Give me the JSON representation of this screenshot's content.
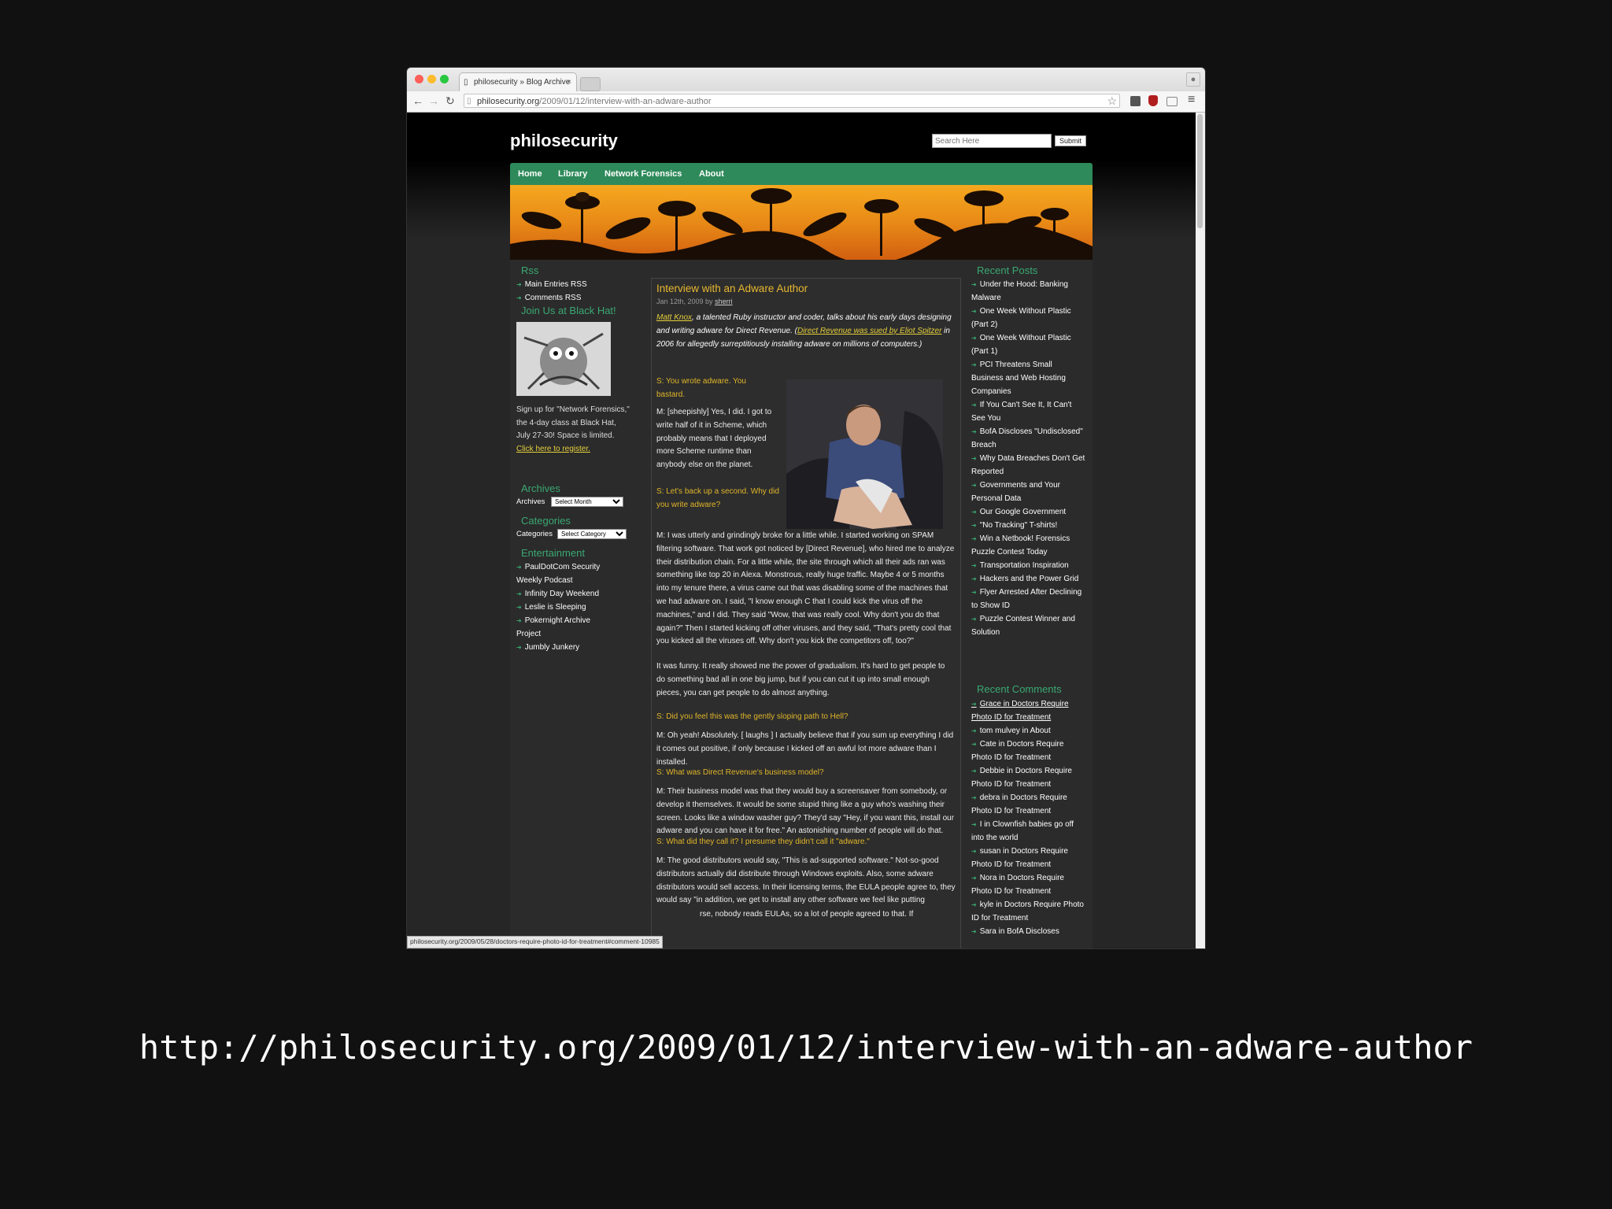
{
  "browser": {
    "tab_title": "philosecurity » Blog Archive",
    "tab_close": "×",
    "url_domain": "philosecurity.org",
    "url_path": "/2009/01/12/interview-with-an-adware-author",
    "status_url": "philosecurity.org/2009/05/28/doctors-require-photo-id-for-treatment#comment-10985",
    "back_glyph": "←",
    "forward_glyph": "→",
    "reload_glyph": "↻",
    "star_glyph": "☆",
    "menu_glyph": "≡"
  },
  "site": {
    "title": "philosecurity",
    "search_placeholder": "Search Here",
    "search_submit": "Submit",
    "nav": [
      "Home",
      "Library",
      "Network Forensics",
      "About"
    ]
  },
  "left_sidebar": {
    "rss_title": "Rss",
    "rss_links": [
      "Main Entries RSS",
      "Comments RSS"
    ],
    "blackhat_title": "Join Us at Black Hat!",
    "blackhat_text": "Sign up for \"Network Forensics,\" the 4-day class at Black Hat, July 27-30! Space is limited.",
    "blackhat_link": "Click here to register.",
    "archives_title": "Archives",
    "archives_label": "Archives",
    "archives_select": "Select Month",
    "categories_title": "Categories",
    "categories_label": "Categories",
    "categories_select": "Select Category",
    "entertainment_title": "Entertainment",
    "entertainment_links": [
      "PaulDotCom Security Weekly Podcast",
      "Infinity Day Weekend",
      "Leslie is Sleeping",
      "Pokernight Archive Project",
      "Jumbly Junkery"
    ]
  },
  "article": {
    "title": "Interview with an Adware Author",
    "date": "Jan 12th, 2009 by",
    "author": "sherri",
    "intro_link1": "Matt Knox",
    "intro_text1": ", a talented Ruby instructor and coder, talks about his early days designing and writing adware for Direct Revenue. (",
    "intro_link2": "Direct Revenue was sued by Eliot Spitzer",
    "intro_text2": " in 2006 for allegedly surreptitiously installing adware on millions of computers.)",
    "q1": "S: You wrote adware. You bastard.",
    "a1": "M: [sheepishly] Yes, I did. I got to write half of it in Scheme, which probably means that I deployed more Scheme runtime than anybody else on the planet.",
    "q2": "S: Let's back up a second. Why did you write adware?",
    "a2": "M: I was utterly and grindingly broke for a little while. I started working on SPAM filtering software. That work got noticed by [Direct Revenue], who hired me to analyze their distribution chain. For a little while, the site through which all their ads ran was something like top 20 in Alexa. Monstrous, really huge traffic. Maybe 4 or 5 months into my tenure there, a virus came out that was disabling some of the machines that we had adware on. I said, \"I know enough C that I could kick the virus off the machines,\" and I did. They said \"Wow, that was really cool. Why don't you do that again?\" Then I started kicking off other viruses, and they said, \"That's pretty cool that you kicked all the viruses off. Why don't you kick the competitors off, too?\"",
    "a2b": "It was funny. It really showed me the power of gradualism. It's hard to get people to do something bad all in one big jump, but if you can cut it up into small enough pieces, you can get people to do almost anything.",
    "q3": "S: Did you feel this was the gently sloping path to Hell?",
    "a3": "M: Oh yeah! Absolutely. [ laughs ] I actually believe that if you sum up everything I did it comes out positive, if only because I kicked off an awful lot more adware than I installed.",
    "q4": "S: What was Direct Revenue's business model?",
    "a4": "M: Their business model was that they would buy a screensaver from somebody, or develop it themselves. It would be some stupid thing like a guy who's washing their screen. Looks like a window washer guy? They'd say \"Hey, if you want this, install our adware and you can have it for free.\" An astonishing number of people will do that.",
    "q5": "S: What did they call it? I presume they didn't call it \"adware.\"",
    "a5": "M: The good distributors would say, \"This is ad-supported software.\" Not-so-good distributors actually did distribute through Windows exploits. Also, some adware distributors would sell access. In their licensing terms, the EULA people agree to, they would say \"in addition, we get to install any other software we feel like putting",
    "a5_tail": "rse, nobody reads EULAs, so a lot of people agreed to that. If"
  },
  "right_sidebar": {
    "recent_posts_title": "Recent Posts",
    "recent_posts": [
      "Under the Hood: Banking Malware",
      "One Week Without Plastic (Part 2)",
      "One Week Without Plastic (Part 1)",
      "PCI Threatens Small Business and Web Hosting Companies",
      "If You Can't See It, It Can't See You",
      "BofA Discloses \"Undisclosed\" Breach",
      "Why Data Breaches Don't Get Reported",
      "Governments and Your Personal Data",
      "Our Google Government",
      "\"No Tracking\" T-shirts!",
      "Win a Netbook! Forensics Puzzle Contest Today",
      "Transportation Inspiration",
      "Hackers and the Power Grid",
      "Flyer Arrested After Declining to Show ID",
      "Puzzle Contest Winner and Solution"
    ],
    "recent_comments_title": "Recent Comments",
    "recent_comments": [
      "Grace in Doctors Require Photo ID for Treatment",
      "tom mulvey in About",
      "Cate in Doctors Require Photo ID for Treatment",
      "Debbie in Doctors Require Photo ID for Treatment",
      "debra in Doctors Require Photo ID for Treatment",
      "I in Clownfish babies go off into the world",
      "susan in Doctors Require Photo ID for Treatment",
      "Nora in Doctors Require Photo ID for Treatment",
      "kyle in Doctors Require Photo ID for Treatment",
      "Sara in BofA Discloses"
    ]
  },
  "slide_caption": "http://philosecurity.org/2009/01/12/interview-with-an-adware-author",
  "colors": {
    "nav_green": "#2e8a5a",
    "widget_title_green": "#3aa872",
    "post_title_gold": "#e8b830",
    "link_yellow": "#e5cf3c"
  },
  "icons": [
    "back-arrow-icon",
    "forward-arrow-icon",
    "reload-icon",
    "page-icon",
    "star-icon",
    "extension-icon",
    "ublock-icon",
    "cast-icon",
    "menu-icon",
    "profile-icon"
  ]
}
